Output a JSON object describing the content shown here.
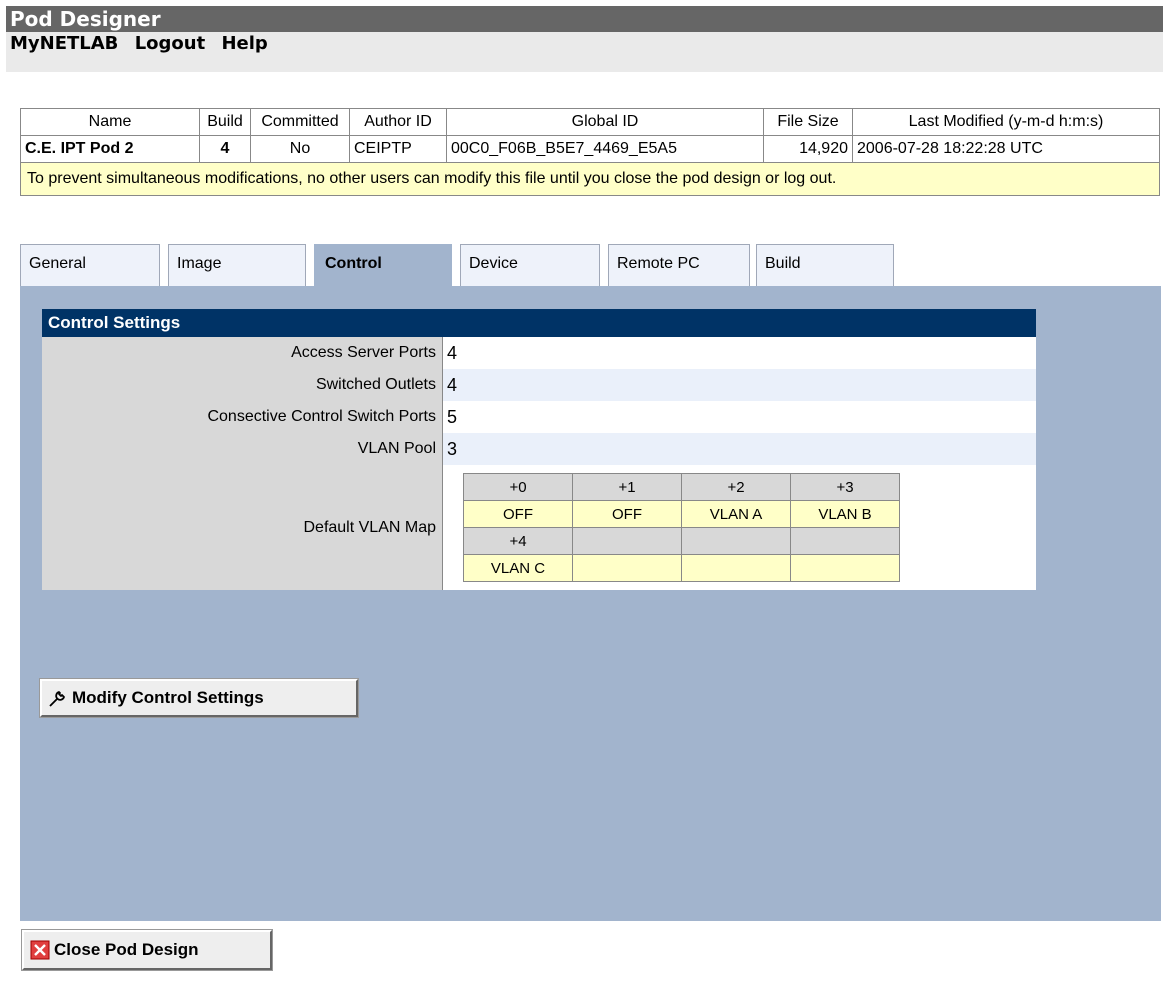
{
  "app": {
    "title": "Pod Designer"
  },
  "menu": {
    "items": [
      "MyNETLAB",
      "Logout",
      "Help"
    ]
  },
  "pod": {
    "headers": [
      "Name",
      "Build",
      "Committed",
      "Author ID",
      "Global ID",
      "File Size",
      "Last Modified (y-m-d h:m:s)"
    ],
    "name": "C.E. IPT Pod 2",
    "build": "4",
    "committed": "No",
    "author_id": "CEIPTP",
    "global_id": "00C0_F06B_B5E7_4469_E5A5",
    "file_size": "14,920",
    "last_modified": "2006-07-28 18:22:28 UTC",
    "notice": "To prevent simultaneous modifications, no other users can modify this file until you close the pod design or log out."
  },
  "tabs": [
    "General",
    "Image",
    "Control",
    "Device",
    "Remote PC",
    "Build"
  ],
  "active_tab": "Control",
  "control": {
    "title": "Control Settings",
    "access_server_ports_label": "Access Server Ports",
    "access_server_ports": "4",
    "switched_outlets_label": "Switched Outlets",
    "switched_outlets": "4",
    "consecutive_ports_label": "Consective Control Switch Ports",
    "consecutive_ports": "5",
    "vlan_pool_label": "VLAN Pool",
    "vlan_pool": "3",
    "default_vlan_map_label": "Default VLAN Map",
    "vlan_map": {
      "offsets_row1": [
        "+0",
        "+1",
        "+2",
        "+3"
      ],
      "values_row1": [
        "OFF",
        "OFF",
        "VLAN A",
        "VLAN B"
      ],
      "offsets_row2": [
        "+4",
        "",
        "",
        ""
      ],
      "values_row2": [
        "VLAN C",
        "",
        "",
        ""
      ]
    },
    "modify_button": "Modify Control Settings"
  },
  "close_button": "Close Pod Design",
  "icons": {
    "modify": "wrench-icon",
    "close": "close-x-icon"
  },
  "colors": {
    "panel": "#a2b4cd",
    "header_bar": "#003366",
    "notice": "#ffffc8",
    "title_bar": "#666666"
  }
}
